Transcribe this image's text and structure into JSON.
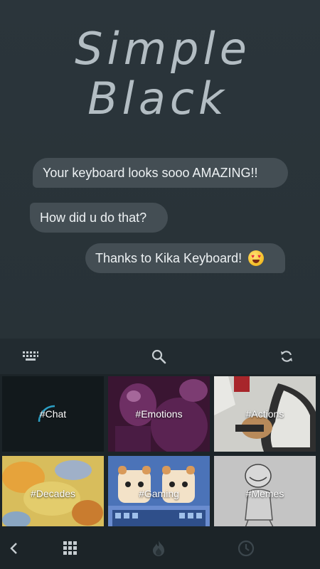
{
  "hero": {
    "title_line1": "Simple",
    "title_line2": "Black"
  },
  "chat": {
    "messages": [
      {
        "text": "Your keyboard looks sooo AMAZING!!"
      },
      {
        "text": "How did u do that?"
      },
      {
        "text": "Thanks to Kika Keyboard!",
        "emoji": "heart-eyes-emoji"
      }
    ]
  },
  "keyboard": {
    "toolbar": {
      "left_icon": "keyboard-icon",
      "center_icon": "search-icon",
      "right_icon": "refresh-icon"
    },
    "categories": [
      {
        "label": "#Chat"
      },
      {
        "label": "#Emotions"
      },
      {
        "label": "#Actions"
      },
      {
        "label": "#Decades"
      },
      {
        "label": "#Gaming"
      },
      {
        "label": "#Memes"
      }
    ],
    "bottom_bar": {
      "icons": [
        "back-arrow-icon",
        "grid-icon",
        "fire-icon",
        "clock-icon"
      ]
    }
  },
  "colors": {
    "background": "#263035",
    "bubble": "#444e54",
    "title": "#b3bdc3",
    "keyboard_bg": "#1c2428",
    "icon": "#c6cdd1"
  }
}
